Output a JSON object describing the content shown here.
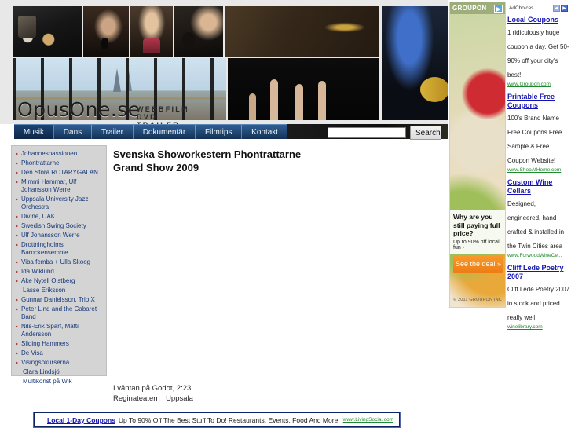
{
  "site": {
    "logo": {
      "text": "OpusOne.se",
      "subtitle": "WEBBFILM DVD TRAILER"
    },
    "nav": [
      {
        "label": "Musik",
        "active": true
      },
      {
        "label": "Dans",
        "active": false
      },
      {
        "label": "Trailer",
        "active": false
      },
      {
        "label": "Dokumentär",
        "active": false
      },
      {
        "label": "Filmtips",
        "active": false
      },
      {
        "label": "Kontakt",
        "active": false
      }
    ],
    "search": {
      "value": "",
      "placeholder": "",
      "button_label": "Search"
    },
    "sidebar": {
      "items": [
        {
          "label": "Johannespassionen",
          "bullet": true
        },
        {
          "label": "Phontrattarne",
          "bullet": true
        },
        {
          "label": "Den Stora ROTARYGALAN",
          "bullet": true
        },
        {
          "label": "Mimmi Hammar, Ulf Johansson Werre",
          "bullet": true
        },
        {
          "label": "Uppsala University Jazz Orchestra",
          "bullet": true
        },
        {
          "label": "Divine, UAK",
          "bullet": true
        },
        {
          "label": "Swedish Swing Society",
          "bullet": true
        },
        {
          "label": "Ulf Johansson Werre",
          "bullet": true
        },
        {
          "label": "Drottningholms Barockensemble",
          "bullet": true
        },
        {
          "label": "Viba femba + Ulla Skoog",
          "bullet": true
        },
        {
          "label": "Ida Wiklund",
          "bullet": true
        },
        {
          "label": "Ake Nytell Olstberg",
          "bullet": true
        },
        {
          "label": "Lasse Eriksson",
          "bullet": false
        },
        {
          "label": "Gunnar Danielsson, Trio X",
          "bullet": true
        },
        {
          "label": "Peter Lind and the Cabaret Band",
          "bullet": true
        },
        {
          "label": "Nils-Erik Sparf, Matti Andersson",
          "bullet": true
        },
        {
          "label": "Sliding Hammers",
          "bullet": true
        },
        {
          "label": "De Visa",
          "bullet": true
        },
        {
          "label": "Visingsökurserna",
          "bullet": true
        },
        {
          "label": "Clara Lindsjö",
          "bullet": false
        },
        {
          "label": "Multikonst på Wik",
          "bullet": false
        }
      ]
    },
    "content": {
      "title_line1": "Svenska Showorkestern Phontrattarne",
      "title_line2": "Grand Show 2009",
      "caption_line1": "I väntan på Godot, 2:23",
      "caption_line2": "Reginateatern i Uppsala"
    }
  },
  "bottom_ad": {
    "link_label": "Local 1-Day Coupons",
    "text": "Up To 90% Off The Best Stuff To Do! Restaurants, Events, Food And More.",
    "url": "www.LivingSocial.com"
  },
  "ads": {
    "adchoices_label": "AdChoices",
    "nav_prev": "◀",
    "nav_next": "▶",
    "groupon": {
      "brand": "GROUPON",
      "headline": "Why are you still paying full price?",
      "subline": "Up to 90% off local fun ›",
      "cta": "See the deal »",
      "legal": "© 2011 GROUPON INC"
    },
    "text_ads": [
      {
        "title": "Local Coupons",
        "desc": "1 ridiculously huge coupon a day. Get 50-90% off your city's best!",
        "url": "www.Groupon.com"
      },
      {
        "title": "Printable Free Coupons",
        "desc": "100's Brand Name Free Coupons Free Sample & Free Coupon Website!",
        "url": "www.ShopAtHome.com"
      },
      {
        "title": "Custom Wine Cellars",
        "desc": "Designed, engineered, hand crafted & installed in the Twin Cities area",
        "url": "www.ForwoodWineCe..."
      },
      {
        "title": "Cliff Lede Poetry 2007",
        "desc": "Cliff Lede Poetry 2007 in stock and priced really well",
        "url": "winelibrary.com"
      }
    ]
  },
  "colors": {
    "nav_blue": "#234b79",
    "link_blue": "#1414b0",
    "sidebar_link": "#16387a",
    "green_url": "#1f8a2f",
    "groupon_orange": "#ee7d14"
  }
}
